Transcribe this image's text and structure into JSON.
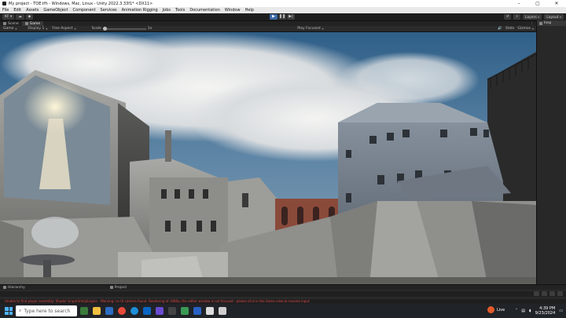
{
  "window": {
    "title": "My project - TOE.tfh - Windows, Mac, Linux - Unity 2022.3.33f1* <DX11>",
    "controls": [
      "–",
      "▢",
      "✕"
    ]
  },
  "menu": [
    "File",
    "Edit",
    "Assets",
    "GameObject",
    "Component",
    "Services",
    "Animation Rigging",
    "Jobs",
    "Tools",
    "Documentation",
    "Window",
    "Help"
  ],
  "toolbar": {
    "account_label": "KF ▾",
    "layers_label": "Layers",
    "layout_label": "Layout"
  },
  "view_tabs": [
    {
      "label": "Scene",
      "active": false
    },
    {
      "label": "Game",
      "active": true
    }
  ],
  "game_controls": {
    "mode": "Game",
    "display": "Display 1",
    "aspect": "Free Aspect",
    "scale_label": "Scale",
    "scale_value": "1x",
    "play_focused": "Play Focused",
    "stats": "Stats",
    "gizmos": "Gizmos"
  },
  "right_panel": {
    "tab": "Insp"
  },
  "bottom_tabs": [
    {
      "label": "Hierarchy"
    },
    {
      "label": "Project"
    }
  ],
  "console_message": "Unable to find player assembly: Shader Graph/UnityEngine - Warning: no UI camera found. Rendering at 1080p; the editor window is not focused - please click in the Game view to resume input.",
  "taskbar": {
    "search_placeholder": "Type here to search",
    "weather_text": "Live",
    "time": "4:39 PM",
    "date": "9/23/2024"
  },
  "colors": {
    "accent": "#3d6aa8",
    "error": "#dd4444",
    "sky_top": "#3b6d96"
  },
  "icons": {
    "play": "▶",
    "pause": "❚❚",
    "step": "▶|",
    "search": "⌕"
  }
}
